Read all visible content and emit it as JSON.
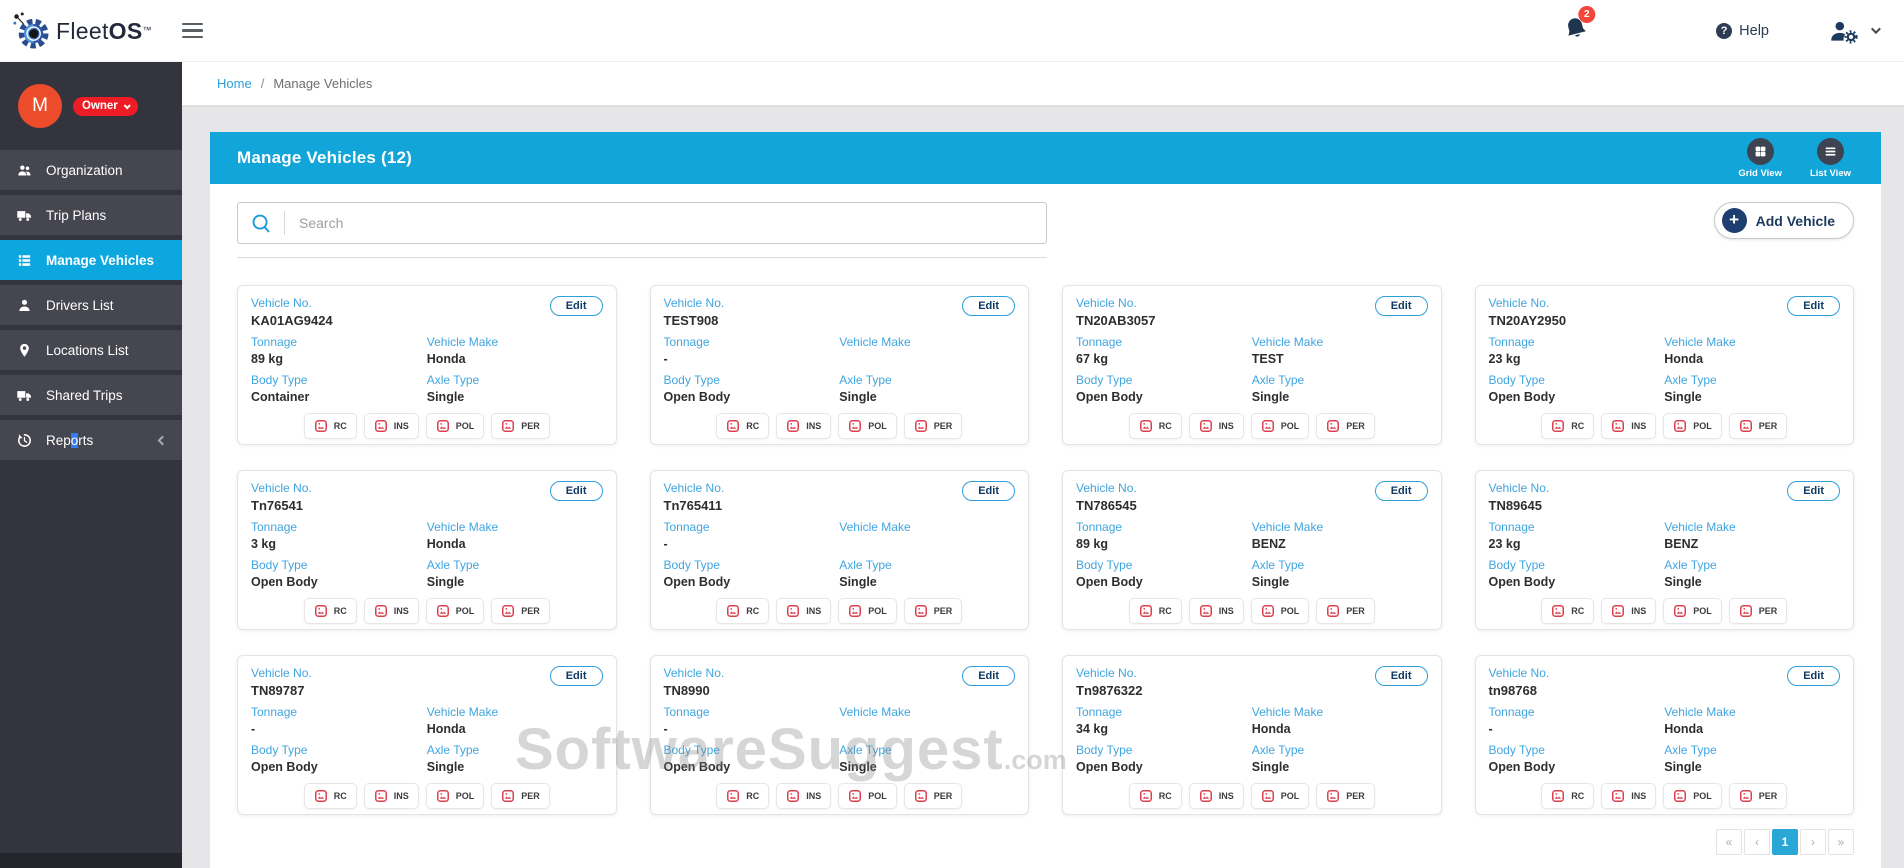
{
  "header": {
    "brand_fleet": "Fleet",
    "brand_os": "OS",
    "brand_tm": "™",
    "notification_count": "2",
    "help_label": "Help"
  },
  "breadcrumb": {
    "home": "Home",
    "separator": "/",
    "current": "Manage Vehicles"
  },
  "sidebar": {
    "avatar_letter": "M",
    "role_badge": "Owner",
    "items": [
      {
        "label": "Organization",
        "icon": "people",
        "active": false
      },
      {
        "label": "Trip Plans",
        "icon": "truck",
        "active": false
      },
      {
        "label": "Manage Vehicles",
        "icon": "list",
        "active": true
      },
      {
        "label": "Drivers List",
        "icon": "person",
        "active": false
      },
      {
        "label": "Locations List",
        "icon": "pin",
        "active": false
      },
      {
        "label": "Shared Trips",
        "icon": "truck",
        "active": false
      },
      {
        "label": "Reports",
        "icon": "history",
        "active": false,
        "has_chevron": true,
        "label_parts": [
          "Rep",
          "o",
          "rts"
        ]
      }
    ]
  },
  "page": {
    "title": "Manage Vehicles (12)",
    "grid_view_label": "Grid View",
    "list_view_label": "List View",
    "search_placeholder": "Search",
    "add_vehicle_label": "Add Vehicle",
    "edit_label": "Edit",
    "labels": {
      "vehicle_no": "Vehicle No.",
      "tonnage": "Tonnage",
      "vehicle_make": "Vehicle Make",
      "body_type": "Body Type",
      "axle_type": "Axle Type"
    },
    "doc_badges": [
      "RC",
      "INS",
      "POL",
      "PER"
    ]
  },
  "vehicles": [
    {
      "vehicle_no": "KA01AG9424",
      "tonnage": "89 kg",
      "make": "Honda",
      "body_type": "Container",
      "axle_type": "Single"
    },
    {
      "vehicle_no": "TEST908",
      "tonnage": "-",
      "make": "",
      "body_type": "Open Body",
      "axle_type": "Single"
    },
    {
      "vehicle_no": "TN20AB3057",
      "tonnage": "67 kg",
      "make": "TEST",
      "body_type": "Open Body",
      "axle_type": "Single"
    },
    {
      "vehicle_no": "TN20AY2950",
      "tonnage": "23 kg",
      "make": "Honda",
      "body_type": "Open Body",
      "axle_type": "Single"
    },
    {
      "vehicle_no": "Tn76541",
      "tonnage": "3 kg",
      "make": "Honda",
      "body_type": "Open Body",
      "axle_type": "Single"
    },
    {
      "vehicle_no": "Tn765411",
      "tonnage": "-",
      "make": "",
      "body_type": "Open Body",
      "axle_type": "Single"
    },
    {
      "vehicle_no": "TN786545",
      "tonnage": "89 kg",
      "make": "BENZ",
      "body_type": "Open Body",
      "axle_type": "Single"
    },
    {
      "vehicle_no": "TN89645",
      "tonnage": "23 kg",
      "make": "BENZ",
      "body_type": "Open Body",
      "axle_type": "Single"
    },
    {
      "vehicle_no": "TN89787",
      "tonnage": "-",
      "make": "Honda",
      "body_type": "Open Body",
      "axle_type": "Single"
    },
    {
      "vehicle_no": "TN8990",
      "tonnage": "-",
      "make": "",
      "body_type": "Open Body",
      "axle_type": "Single"
    },
    {
      "vehicle_no": "Tn9876322",
      "tonnage": "34 kg",
      "make": "Honda",
      "body_type": "Open Body",
      "axle_type": "Single"
    },
    {
      "vehicle_no": "tn98768",
      "tonnage": "-",
      "make": "Honda",
      "body_type": "Open Body",
      "axle_type": "Single"
    }
  ],
  "pagination": {
    "buttons": [
      "«",
      "‹",
      "1",
      "›",
      "»"
    ],
    "active": "1"
  },
  "watermark": {
    "text": "SoftwareSuggest",
    "suffix": ".com"
  },
  "colors": {
    "accent_blue": "#12a5d9",
    "sidebar_bg": "#33343e",
    "sidebar_item": "#45464f",
    "sidebar_active": "#0ba7de",
    "label_blue": "#3fa5e0",
    "navy": "#1c3a5e",
    "danger_red": "#ee1c25",
    "doc_icon_red": "#dc4150",
    "avatar_orange": "#ed4c2a",
    "page_bg": "#e6e6e8"
  }
}
